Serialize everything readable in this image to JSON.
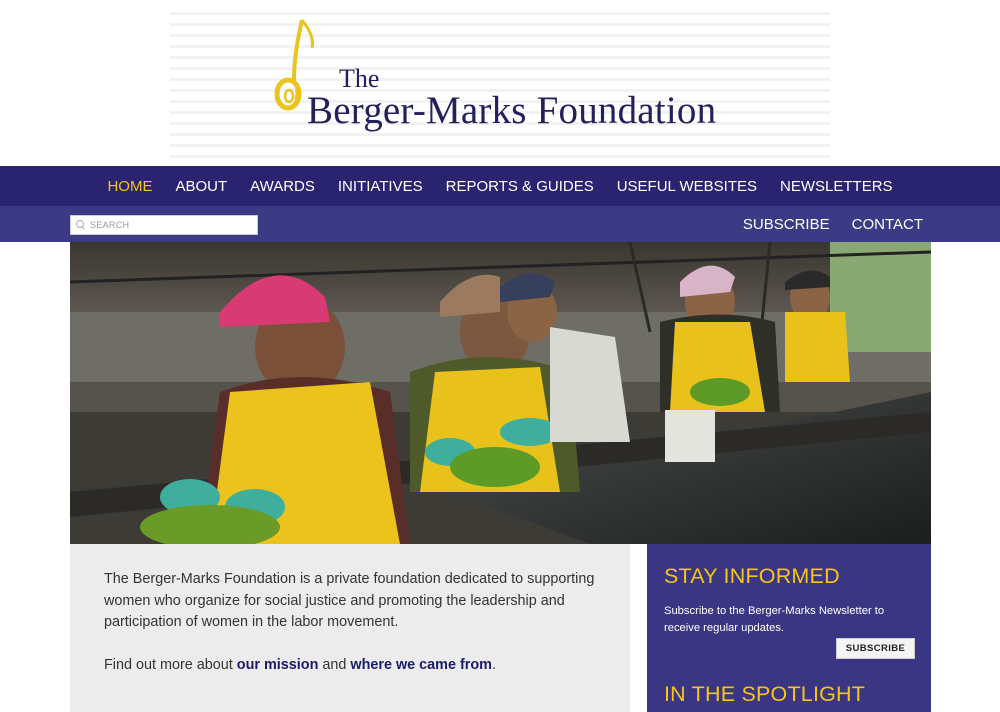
{
  "logo": {
    "line1": "The",
    "line2": "Berger-Marks Foundation"
  },
  "main_nav": {
    "items": [
      {
        "label": "HOME",
        "active": true
      },
      {
        "label": "ABOUT"
      },
      {
        "label": "AWARDS"
      },
      {
        "label": "INITIATIVES"
      },
      {
        "label": "REPORTS & GUIDES"
      },
      {
        "label": "USEFUL WEBSITES"
      },
      {
        "label": "NEWSLETTERS"
      }
    ]
  },
  "sub_nav": {
    "search_placeholder": "SEARCH",
    "links": [
      "SUBSCRIBE",
      "CONTACT"
    ]
  },
  "intro": {
    "paragraph": "The Berger-Marks Foundation is a private foundation dedicated to supporting women who organize for social justice and promoting the leadership and participation of women in the labor movement.",
    "find_prefix": "Find out more about ",
    "mission_link": "our mission",
    "and_text": " and ",
    "history_link": "where we came from",
    "period": "."
  },
  "sidebar": {
    "stay_title": "STAY INFORMED",
    "stay_text": "Subscribe to the Berger-Marks Newsletter to receive regular updates.",
    "subscribe_button": "SUBSCRIBE",
    "spotlight_title": "IN THE SPOTLIGHT"
  },
  "colors": {
    "nav_primary": "#2a2470",
    "nav_secondary": "#3a3a85",
    "accent_yellow": "#f5c518",
    "sidebar_bg": "#3a3683",
    "link_blue": "#1d1a6e"
  },
  "icons": [
    "search-icon",
    "logo-mark-icon"
  ]
}
